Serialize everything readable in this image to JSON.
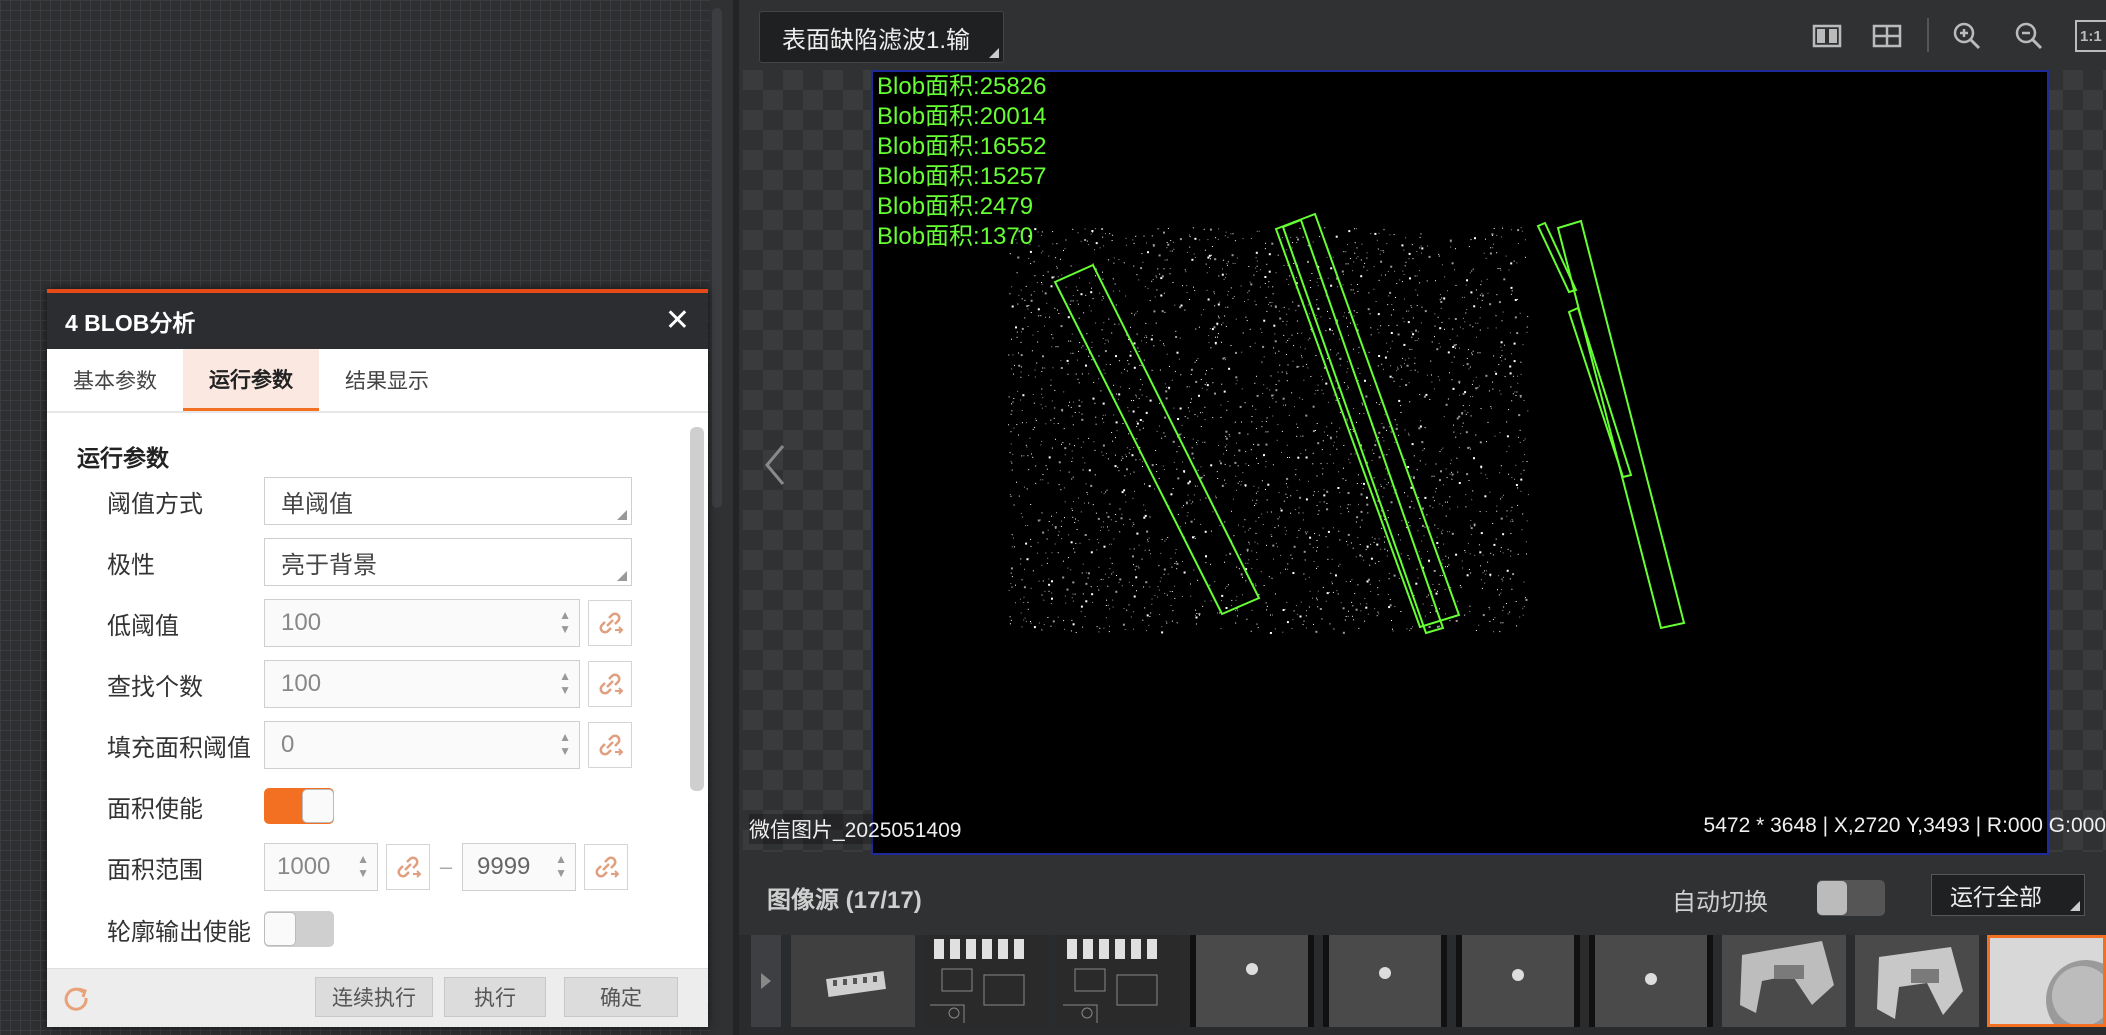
{
  "dialog": {
    "title": "4 BLOB分析",
    "close_symbol": "✕",
    "tabs": [
      "基本参数",
      "运行参数",
      "结果显示"
    ],
    "active_tab": "运行参数",
    "section_title": "运行参数",
    "fields": {
      "threshold_mode": {
        "label": "阈值方式",
        "value": "单阈值"
      },
      "polarity": {
        "label": "极性",
        "value": "亮于背景"
      },
      "low_threshold": {
        "label": "低阈值",
        "value": "100"
      },
      "find_count": {
        "label": "查找个数",
        "value": "100"
      },
      "fill_area_threshold": {
        "label": "填充面积阈值",
        "value": "0"
      },
      "area_enable": {
        "label": "面积使能",
        "value": true
      },
      "area_range": {
        "label": "面积范围",
        "min": "1000",
        "separator": "–",
        "max": "9999"
      },
      "contour_output": {
        "label": "轮廓输出使能",
        "value": false
      }
    },
    "footer": {
      "continuous_run": "连续执行",
      "run": "执行",
      "confirm": "确定"
    }
  },
  "viewer": {
    "source_select": "表面缺陷滤波1.输",
    "blob_labels": [
      "Blob面积:25826",
      "Blob面积:20014",
      "Blob面积:16552",
      "Blob面积:15257",
      "Blob面积:2479",
      "Blob面积:1370"
    ],
    "image_name": "微信图片_2025051409",
    "status": "5472 * 3648  |  X,2720   Y,3493  |  R:000   G:000",
    "zoom_label": "1:1",
    "source_title": "图像源 (17/17)",
    "auto_switch_label": "自动切换",
    "auto_switch": false,
    "run_all": "运行全部"
  },
  "colors": {
    "accent": "#f36f21",
    "blob": "#66ff33",
    "dialog_top": "#e64a19"
  }
}
